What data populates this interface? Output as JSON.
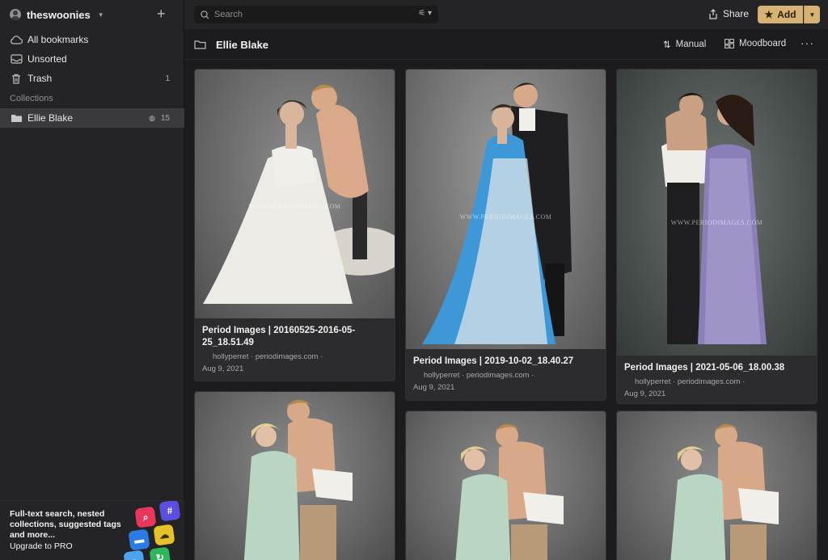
{
  "sidebar": {
    "user": "theswoonies",
    "nav": [
      {
        "label": "All bookmarks",
        "icon": "cloud-icon"
      },
      {
        "label": "Unsorted",
        "icon": "inbox-icon"
      },
      {
        "label": "Trash",
        "icon": "trash-icon",
        "count": "1"
      }
    ],
    "section": "Collections",
    "collection": {
      "label": "Ellie Blake",
      "count": "15",
      "icon": "folder-icon"
    },
    "promo": {
      "text": "Full-text search, nested collections, suggested tags and more...",
      "link": "Upgrade to PRO"
    }
  },
  "topbar": {
    "search_placeholder": "Search",
    "share_label": "Share",
    "add_label": "Add"
  },
  "collection_header": {
    "title": "Ellie Blake",
    "sort_label": "Manual",
    "view_label": "Moodboard",
    "more": "···"
  },
  "cards": [
    {
      "title": "Period Images | 20160525-2016-05-25_18.51.49",
      "author": "hollyperret",
      "domain": "periodimages.com",
      "date": "Aug 9, 2021"
    },
    {
      "title": "Period Images | 2019-10-02_18.40.27",
      "author": "hollyperret",
      "domain": "periodimages.com",
      "date": "Aug 9, 2021"
    },
    {
      "title": "Period Images | 2021-05-06_18.00.38",
      "author": "hollyperret",
      "domain": "periodimages.com",
      "date": "Aug 9, 2021"
    }
  ],
  "watermark": "WWW.PERIODIMAGES.COM",
  "colors": {
    "accent": "#d6b274",
    "sidebar": "#242426",
    "background": "#1c1c1e"
  }
}
